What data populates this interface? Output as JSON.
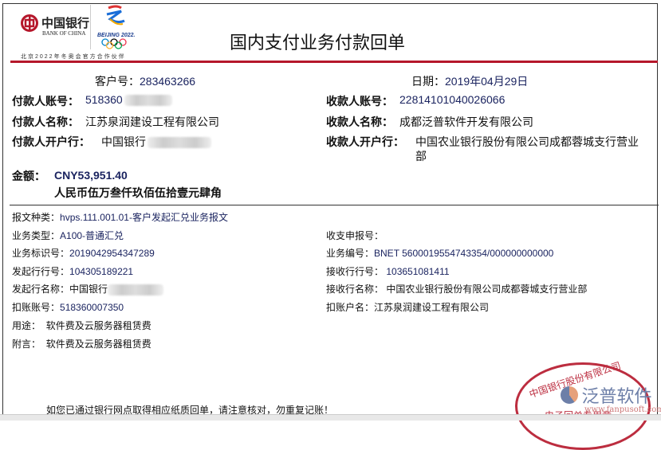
{
  "header": {
    "bank_cn": "中国银行",
    "bank_en": "BANK OF CHINA",
    "olympic": "BEIJING 2022.",
    "partner": "北京2022年冬奥会官方合作伙伴",
    "title": "国内支付业务付款回单"
  },
  "customer": {
    "label": "客户号：",
    "value": "283463266"
  },
  "date": {
    "label": "日期：",
    "value": "2019年04月29日"
  },
  "payer": {
    "account_label": "付款人账号：",
    "account": "518360",
    "name_label": "付款人名称：",
    "name": "江苏泉润建设工程有限公司",
    "bank_label": "付款人开户行：",
    "bank": "中国银行"
  },
  "payee": {
    "account_label": "收款人账号：",
    "account": "22814101040026066",
    "name_label": "收款人名称：",
    "name": "成都泛普软件开发有限公司",
    "bank_label": "收款人开户行：",
    "bank_line1": "中国农业银行股份有限公司成都蓉城支行营业",
    "bank_line2": "部"
  },
  "amount": {
    "label": "金额：",
    "value": "CNY53,951.40",
    "words": "人民币伍万叁仟玖佰伍拾壹元肆角"
  },
  "details": {
    "msg_type_label": "报文种类：",
    "msg_type": "hvps.111.001.01-客户发起汇兑业务报文",
    "biz_type_label": "业务类型：",
    "biz_type": "A100-普通汇兑",
    "biz_id_label": "业务标识号：",
    "biz_id": "2019042954347289",
    "from_bank_no_label": "发起行行号：",
    "from_bank_no": "104305189221",
    "from_bank_name_label": "发起行名称：",
    "from_bank_name": "中国银行",
    "debit_acct_label": "扣账账号：",
    "debit_acct": "518360007350",
    "purpose_label": "用途：",
    "purpose": "软件费及云服务器租赁费",
    "note_label": "附言：",
    "note": "软件费及云服务器租赁费",
    "declare_label": "收支申报号：",
    "biz_no_label": "业务编号：",
    "biz_no": "BNET 5600019554743354/000000000000",
    "to_bank_no_label": "接收行行号：",
    "to_bank_no": "103651081411",
    "to_bank_name_label": "接收行名称：",
    "to_bank_name": "中国农业银行股份有限公司成都蓉城支行营业部",
    "debit_name_label": "扣账户名：",
    "debit_name": "江苏泉润建设工程有限公司"
  },
  "footer": {
    "notice": "如您已通过银行网点取得相应纸质回单，请注意核对，勿重复记账！"
  },
  "stamp": {
    "text": "中国银行股份有限公司",
    "sub": "电子回单专用章"
  },
  "watermark": {
    "brand": "泛普软件",
    "url": "www.fanpusoft.com"
  },
  "colors": {
    "red": "#b5172b",
    "value": "#1b2460"
  }
}
